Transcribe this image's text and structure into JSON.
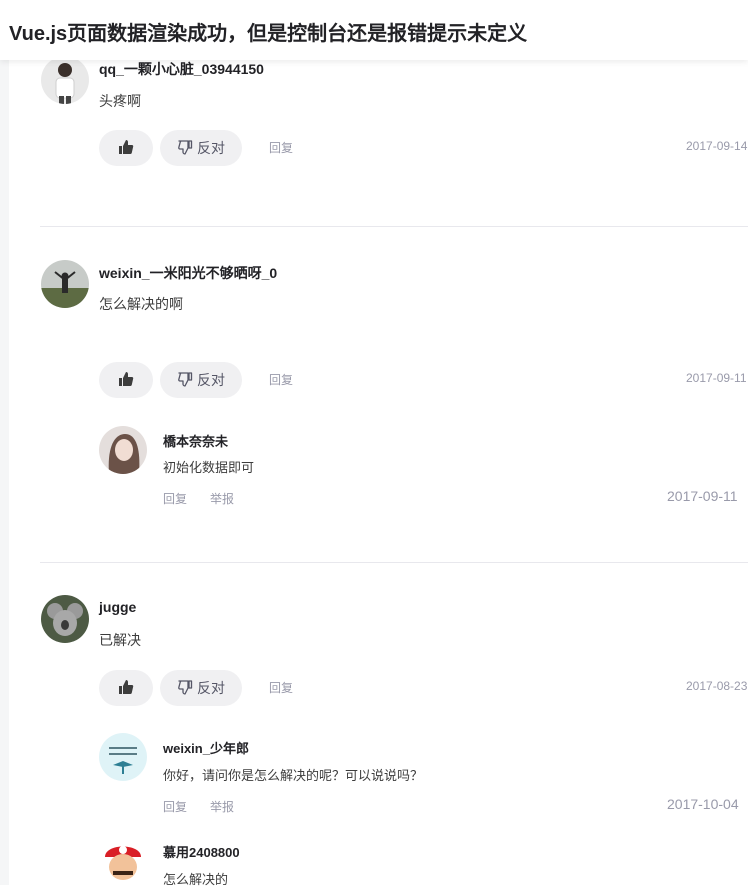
{
  "header": {
    "title": "Vue.js页面数据渲染成功，但是控制台还是报错提示未定义"
  },
  "actions": {
    "dislike_label": "反对",
    "reply_label": "回复",
    "report_label": "举报"
  },
  "comments": [
    {
      "username": "qq_一颗小心脏_03944150",
      "text": "头疼啊",
      "date": "2017-09-14"
    },
    {
      "username": "weixin_一米阳光不够晒呀_0",
      "text": "怎么解决的啊",
      "date": "2017-09-11",
      "replies": [
        {
          "username": "橋本奈奈未",
          "text": "初始化数据即可",
          "date": "2017-09-11"
        }
      ]
    },
    {
      "username": "jugge",
      "text": "已解决",
      "date": "2017-08-23",
      "replies": [
        {
          "username": "weixin_少年郎",
          "text": "你好，请问你是怎么解决的呢？可以说说吗？",
          "date": "2017-10-04"
        },
        {
          "username": "慕用2408800",
          "text": "怎么解决的"
        }
      ]
    }
  ]
}
